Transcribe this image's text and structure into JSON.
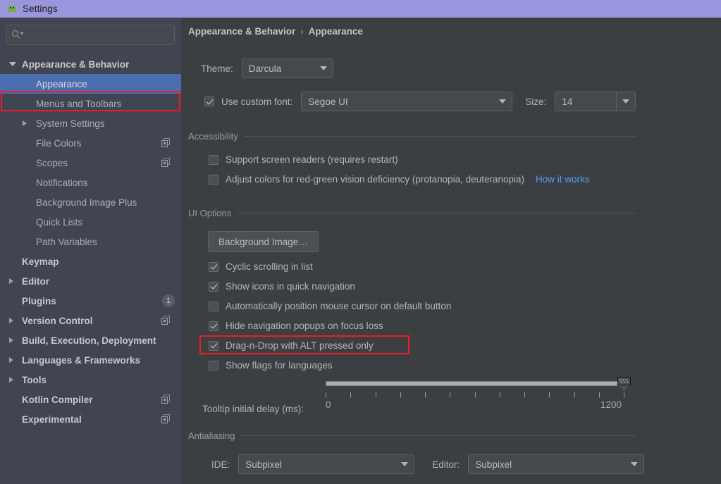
{
  "window": {
    "title": "Settings",
    "icon": "android-icon",
    "titlebar_color": "#9a96dd"
  },
  "sidebar": {
    "search": {
      "value": "",
      "placeholder": "",
      "icon": "search-icon"
    },
    "items": [
      {
        "label": "Appearance & Behavior",
        "level": 0,
        "arrow": "down",
        "selected": false,
        "icon": null,
        "badge": null
      },
      {
        "label": "Appearance",
        "level": 1,
        "arrow": null,
        "selected": true,
        "icon": null,
        "badge": null
      },
      {
        "label": "Menus and Toolbars",
        "level": 1,
        "arrow": null,
        "selected": false,
        "icon": null,
        "badge": null
      },
      {
        "label": "System Settings",
        "level": 1,
        "arrow": "right",
        "selected": false,
        "icon": null,
        "badge": null
      },
      {
        "label": "File Colors",
        "level": 1,
        "arrow": null,
        "selected": false,
        "icon": "copy-icon",
        "badge": null
      },
      {
        "label": "Scopes",
        "level": 1,
        "arrow": null,
        "selected": false,
        "icon": "copy-icon",
        "badge": null
      },
      {
        "label": "Notifications",
        "level": 1,
        "arrow": null,
        "selected": false,
        "icon": null,
        "badge": null
      },
      {
        "label": "Background Image Plus",
        "level": 1,
        "arrow": null,
        "selected": false,
        "icon": null,
        "badge": null
      },
      {
        "label": "Quick Lists",
        "level": 1,
        "arrow": null,
        "selected": false,
        "icon": null,
        "badge": null
      },
      {
        "label": "Path Variables",
        "level": 1,
        "arrow": null,
        "selected": false,
        "icon": null,
        "badge": null
      },
      {
        "label": "Keymap",
        "level": 0,
        "arrow": null,
        "selected": false,
        "icon": null,
        "badge": null
      },
      {
        "label": "Editor",
        "level": 0,
        "arrow": "right",
        "selected": false,
        "icon": null,
        "badge": null
      },
      {
        "label": "Plugins",
        "level": 0,
        "arrow": null,
        "selected": false,
        "icon": null,
        "badge": "1"
      },
      {
        "label": "Version Control",
        "level": 0,
        "arrow": "right",
        "selected": false,
        "icon": "copy-icon",
        "badge": null
      },
      {
        "label": "Build, Execution, Deployment",
        "level": 0,
        "arrow": "right",
        "selected": false,
        "icon": null,
        "badge": null
      },
      {
        "label": "Languages & Frameworks",
        "level": 0,
        "arrow": "right",
        "selected": false,
        "icon": null,
        "badge": null
      },
      {
        "label": "Tools",
        "level": 0,
        "arrow": "right",
        "selected": false,
        "icon": null,
        "badge": null
      },
      {
        "label": "Kotlin Compiler",
        "level": 0,
        "arrow": null,
        "selected": false,
        "icon": "copy-icon",
        "badge": null
      },
      {
        "label": "Experimental",
        "level": 0,
        "arrow": null,
        "selected": false,
        "icon": "copy-icon",
        "badge": null
      }
    ],
    "selection_color": "#4b6eaf"
  },
  "annotations": {
    "color": "#ee1b24",
    "boxes": [
      {
        "name": "appearance-sidebar-item"
      },
      {
        "name": "drag-n-drop-checkbox-row"
      }
    ]
  },
  "main": {
    "breadcrumb": {
      "root": "Appearance & Behavior",
      "separator": "›",
      "current": "Appearance"
    },
    "theme": {
      "label": "Theme:",
      "value": "Darcula"
    },
    "custom_font": {
      "checkbox_label": "Use custom font:",
      "checked": true,
      "font_value": "Segoe UI",
      "size_label": "Size:",
      "size_value": "14"
    },
    "accessibility": {
      "title": "Accessibility",
      "options": [
        {
          "label": "Support screen readers (requires restart)",
          "checked": false
        },
        {
          "label": "Adjust colors for red-green vision deficiency (protanopia, deuteranopia)",
          "checked": false
        }
      ],
      "link": "How it works",
      "link_color": "#589df6"
    },
    "ui_options": {
      "title": "UI Options",
      "background_image_button": "Background Image…",
      "options": [
        {
          "label": "Cyclic scrolling in list",
          "checked": true
        },
        {
          "label": "Show icons in quick navigation",
          "checked": true
        },
        {
          "label": "Automatically position mouse cursor on default button",
          "checked": false
        },
        {
          "label": "Hide navigation popups on focus loss",
          "checked": true
        },
        {
          "label": "Drag-n-Drop with ALT pressed only",
          "checked": true
        },
        {
          "label": "Show flags for languages",
          "checked": false
        }
      ],
      "slider": {
        "label": "Tooltip initial delay (ms):",
        "min_label": "0",
        "max_label": "1200",
        "min": 0,
        "max": 1200,
        "value": 1200,
        "tick_count": 13
      }
    },
    "antialiasing": {
      "title": "Antialiasing",
      "ide_label": "IDE:",
      "ide_value": "Subpixel",
      "editor_label": "Editor:",
      "editor_value": "Subpixel"
    }
  }
}
